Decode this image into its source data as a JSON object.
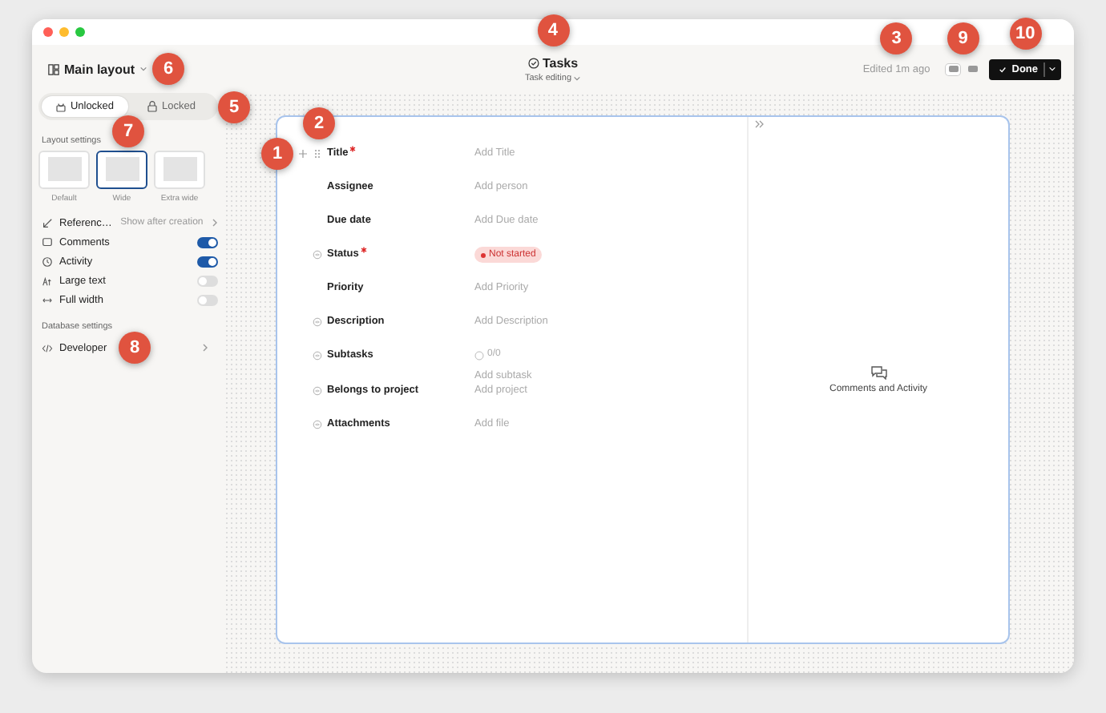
{
  "window": {
    "title": "Tasks",
    "subtitle": "Task editing",
    "edited": "Edited 1m ago",
    "done": "Done",
    "title_callout": "4",
    "edited_callout": "3",
    "done_callout": "10"
  },
  "view_toggle": {
    "callout": "9",
    "options": [
      {
        "selected": true
      },
      {
        "selected": false
      }
    ]
  },
  "sidebar": {
    "layout_name": "Main layout",
    "layout_callout": "6",
    "lock_tabs": [
      {
        "label": "Unlocked",
        "selected": true
      },
      {
        "label": "Locked",
        "selected": false,
        "callout": "5"
      }
    ],
    "layout_section": "Layout settings",
    "widths_callout": "7",
    "widths": [
      {
        "label": "Default",
        "selected": false
      },
      {
        "label": "Wide",
        "selected": true
      },
      {
        "label": "Extra wide",
        "selected": false
      }
    ],
    "settings": [
      {
        "kind": "link",
        "label": "Referenc…",
        "value": "Show after creation"
      },
      {
        "kind": "toggle",
        "label": "Comments",
        "on": true
      },
      {
        "kind": "toggle",
        "label": "Activity",
        "on": true
      },
      {
        "kind": "toggle",
        "label": "Large text",
        "on": false
      },
      {
        "kind": "toggle",
        "label": "Full width",
        "on": false
      }
    ],
    "database_section": "Database settings",
    "database_items": [
      {
        "label": "Developer",
        "callout": "8"
      }
    ]
  },
  "fields": [
    {
      "label": "Title",
      "required": true,
      "eye": false,
      "hovered": true,
      "add_callout": "1",
      "drag_callout": "2",
      "kind": "placeholder",
      "value": "Add Title"
    },
    {
      "label": "Assignee",
      "required": false,
      "eye": false,
      "hovered": false,
      "kind": "placeholder",
      "value": "Add person"
    },
    {
      "label": "Due date",
      "required": false,
      "eye": false,
      "hovered": false,
      "kind": "placeholder",
      "value": "Add Due date"
    },
    {
      "label": "Status",
      "required": true,
      "eye": true,
      "hovered": false,
      "kind": "badge",
      "value": "Not started"
    },
    {
      "label": "Priority",
      "required": false,
      "eye": false,
      "hovered": false,
      "kind": "placeholder",
      "value": "Add Priority"
    },
    {
      "label": "Description",
      "required": false,
      "eye": true,
      "hovered": false,
      "kind": "placeholder",
      "value": "Add Description"
    },
    {
      "label": "Subtasks",
      "required": false,
      "eye": true,
      "hovered": false,
      "kind": "subtasks",
      "count": "0/0",
      "value": "Add subtask"
    },
    {
      "label": "Belongs to project",
      "required": false,
      "eye": true,
      "hovered": false,
      "kind": "placeholder",
      "value": "Add project"
    },
    {
      "label": "Attachments",
      "required": false,
      "eye": true,
      "hovered": false,
      "kind": "placeholder",
      "value": "Add file"
    }
  ],
  "side_panel": {
    "title": "Comments and Activity"
  }
}
